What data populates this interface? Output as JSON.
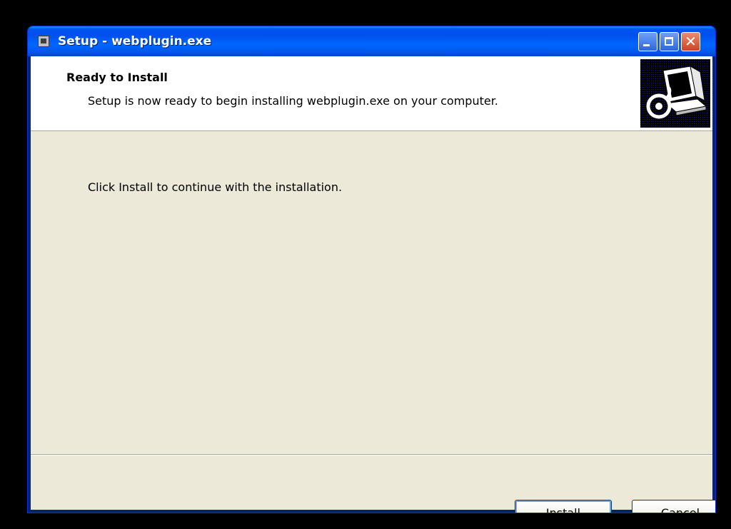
{
  "window": {
    "title": "Setup - webplugin.exe",
    "buttons": {
      "close_glyph": "✕"
    }
  },
  "header": {
    "title": "Ready to Install",
    "subtitle": "Setup is now ready to begin installing webplugin.exe on your computer."
  },
  "body": {
    "text": "Click Install to continue with the installation."
  },
  "footer": {
    "install_label": "Install",
    "cancel_label": "Cancel"
  },
  "colors": {
    "titlebar": "#0055EA",
    "client": "#ECE9D8",
    "header_bg": "#FFFFFF",
    "button_border": "#003C74"
  },
  "icons": [
    "app-icon",
    "minimize-icon",
    "maximize-icon",
    "close-icon",
    "computer-install-icon"
  ]
}
